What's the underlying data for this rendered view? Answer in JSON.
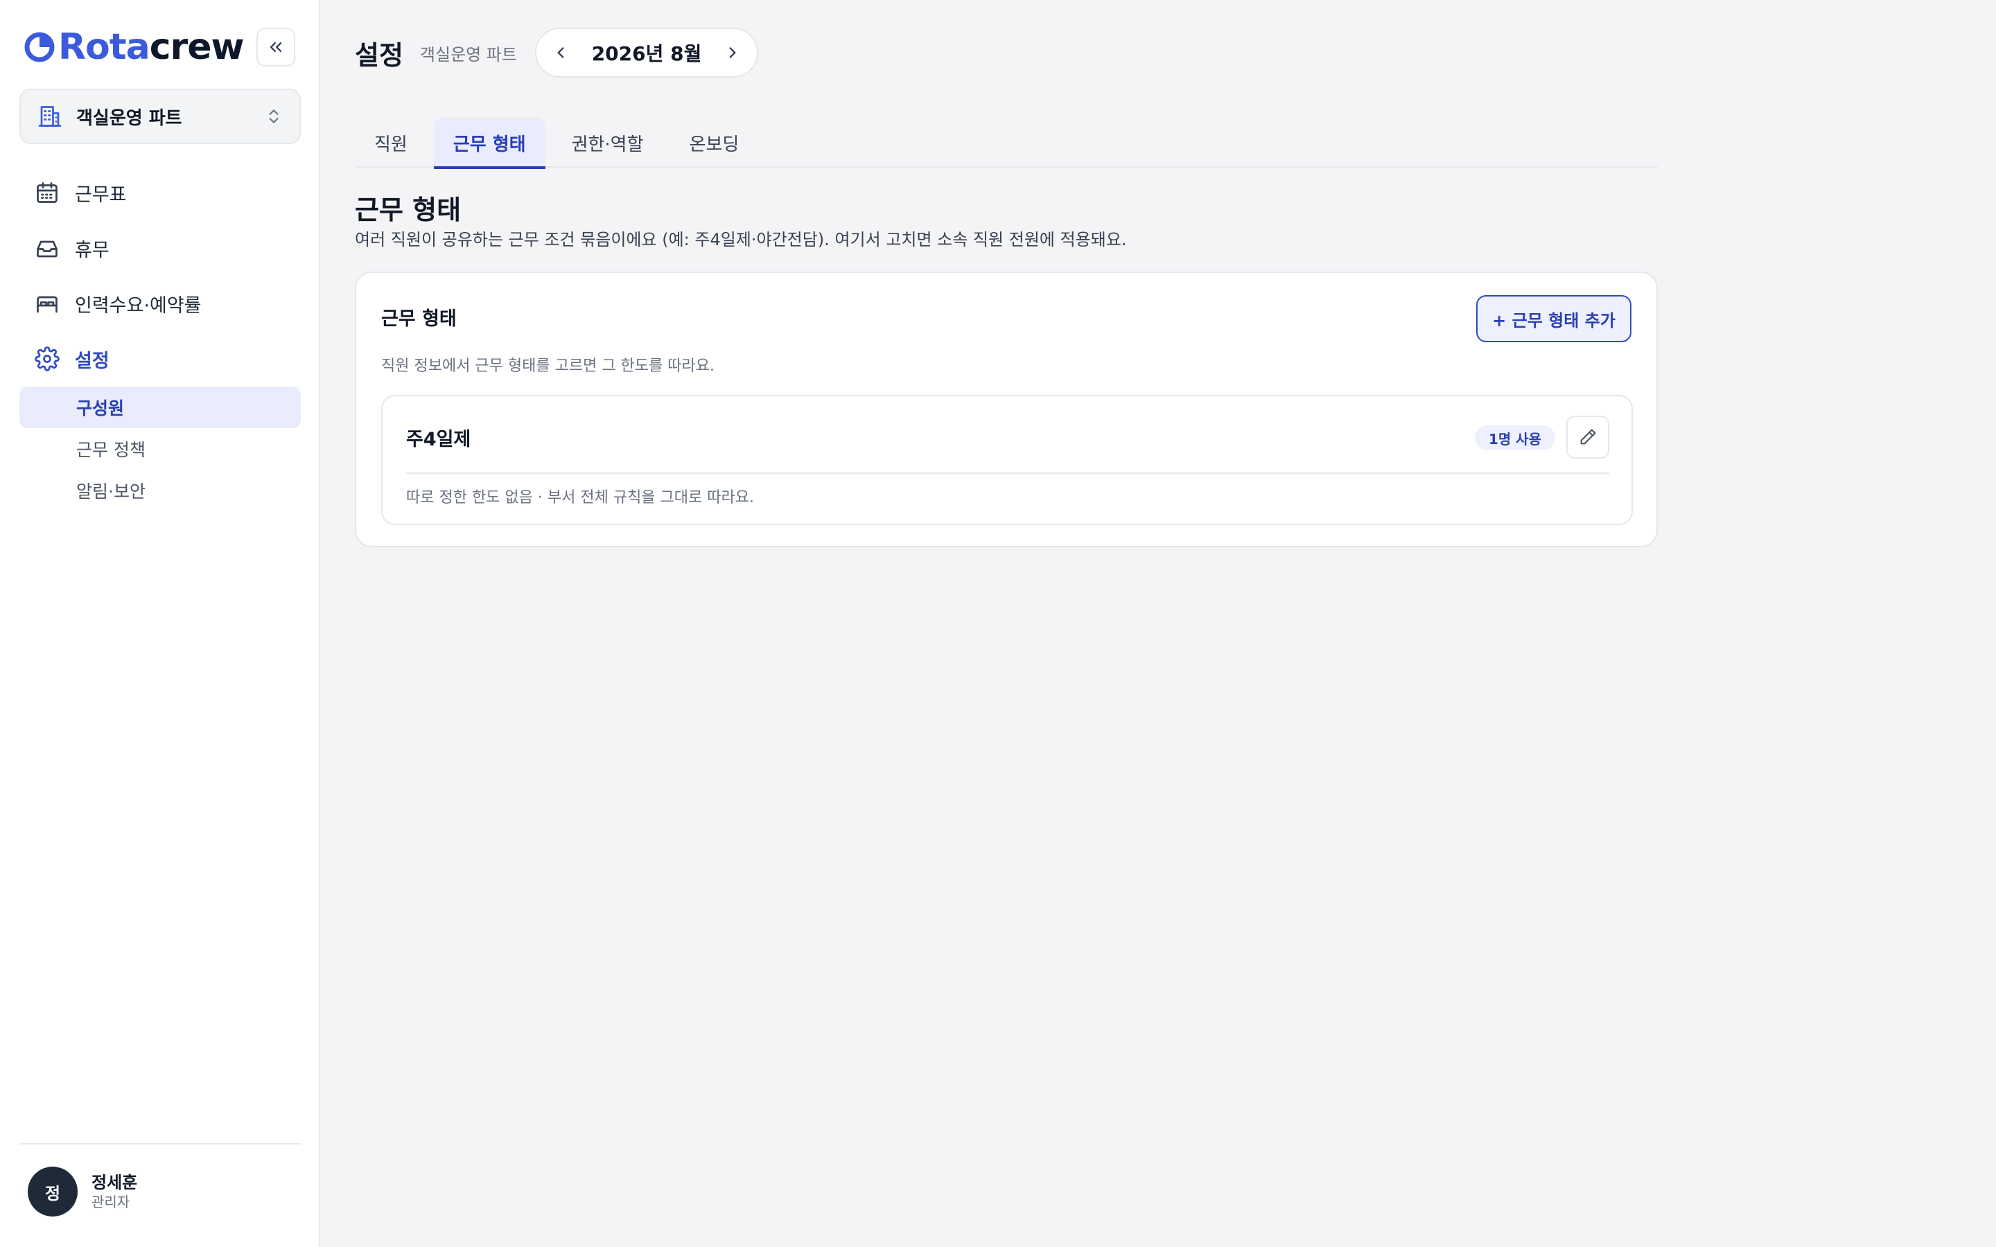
{
  "brand": {
    "part1": "Rota",
    "part2": "crew",
    "accent": "#3b5bdb"
  },
  "team_selector": {
    "label": "객실운영 파트",
    "icon": "building-icon"
  },
  "sidebar": {
    "items": [
      {
        "label": "근무표",
        "icon": "calendar-icon"
      },
      {
        "label": "휴무",
        "icon": "inbox-icon"
      },
      {
        "label": "인력수요·예약률",
        "icon": "bed-icon"
      },
      {
        "label": "설정",
        "icon": "gear-icon",
        "active": true
      }
    ],
    "sub_items": [
      {
        "label": "구성원",
        "active": true
      },
      {
        "label": "근무 정책"
      },
      {
        "label": "알림·보안"
      }
    ]
  },
  "user": {
    "initial": "정",
    "name": "정세훈",
    "role": "관리자"
  },
  "header": {
    "title": "설정",
    "subtitle": "객실운영 파트",
    "month": "2026년 8월"
  },
  "tabs": [
    {
      "label": "직원"
    },
    {
      "label": "근무 형태",
      "active": true
    },
    {
      "label": "권한·역할"
    },
    {
      "label": "온보딩"
    }
  ],
  "section": {
    "title": "근무 형태",
    "description": "여러 직원이 공유하는 근무 조건 묶음이에요 (예: 주4일제·야간전담). 여기서 고치면 소속 직원 전원에 적용돼요."
  },
  "card": {
    "title": "근무 형태",
    "add_label": "+ 근무 형태 추가",
    "description": "직원 정보에서 근무 형태를 고르면 그 한도를 따라요.",
    "items": [
      {
        "name": "주4일제",
        "badge": "1명 사용",
        "description": "따로 정한 한도 없음 · 부서 전체 규칙을 그대로 따라요."
      }
    ]
  }
}
